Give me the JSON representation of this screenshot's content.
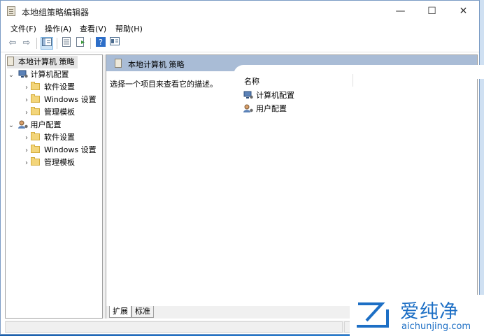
{
  "window": {
    "title": "本地组策略编辑器",
    "minimize_glyph": "—",
    "maximize_glyph": "☐",
    "close_glyph": "✕"
  },
  "menu": [
    "文件(F)",
    "操作(A)",
    "查看(V)",
    "帮助(H)"
  ],
  "toolbar": {
    "back_glyph": "⇦",
    "forward_glyph": "⇨",
    "icons": [
      "back-arrow-icon",
      "forward-arrow-icon",
      "show-hide-tree-icon",
      "properties-icon",
      "export-list-icon",
      "help-icon",
      "view-icon"
    ]
  },
  "tree": {
    "root": "本地计算机 策略",
    "computer": "计算机配置",
    "computer_children": [
      "软件设置",
      "Windows 设置",
      "管理模板"
    ],
    "user": "用户配置",
    "user_children": [
      "软件设置",
      "Windows 设置",
      "管理模板"
    ]
  },
  "details": {
    "header": "本地计算机 策略",
    "description": "选择一个项目来查看它的描述。",
    "column_name": "名称",
    "items": [
      "计算机配置",
      "用户配置"
    ]
  },
  "tabs": [
    "扩展",
    "标准"
  ],
  "watermark": {
    "cn": "爱纯净",
    "en": "aichunjing.com"
  },
  "colors": {
    "header_bar": "#a9bcd6",
    "folder": "#f3d57a",
    "watermark": "#1d6fc5"
  }
}
